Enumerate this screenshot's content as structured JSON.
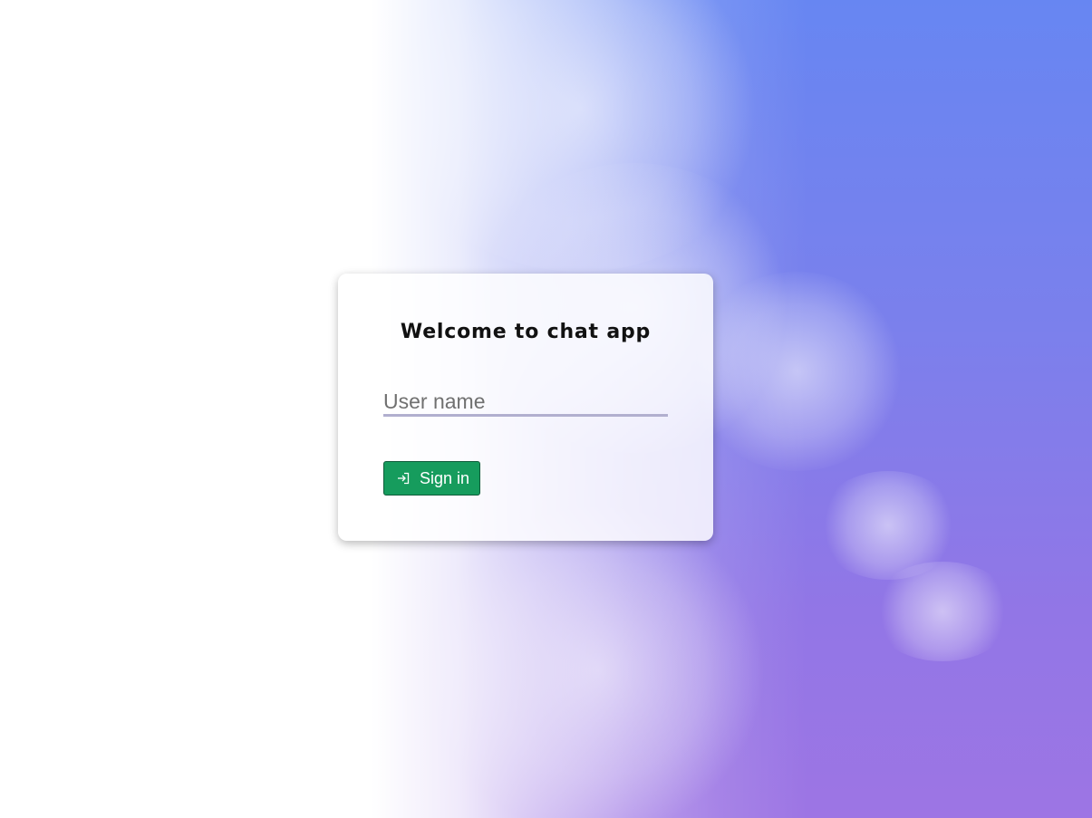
{
  "login": {
    "title": "Welcome to chat app",
    "username_placeholder": "User name",
    "username_value": "",
    "signin_label": "Sign in"
  },
  "colors": {
    "button_bg": "#169c5d",
    "input_underline": "#b1afcf",
    "bg_top": "#6786f2",
    "bg_bottom": "#9d75e4"
  },
  "icons": {
    "signin": "sign-in-icon"
  }
}
